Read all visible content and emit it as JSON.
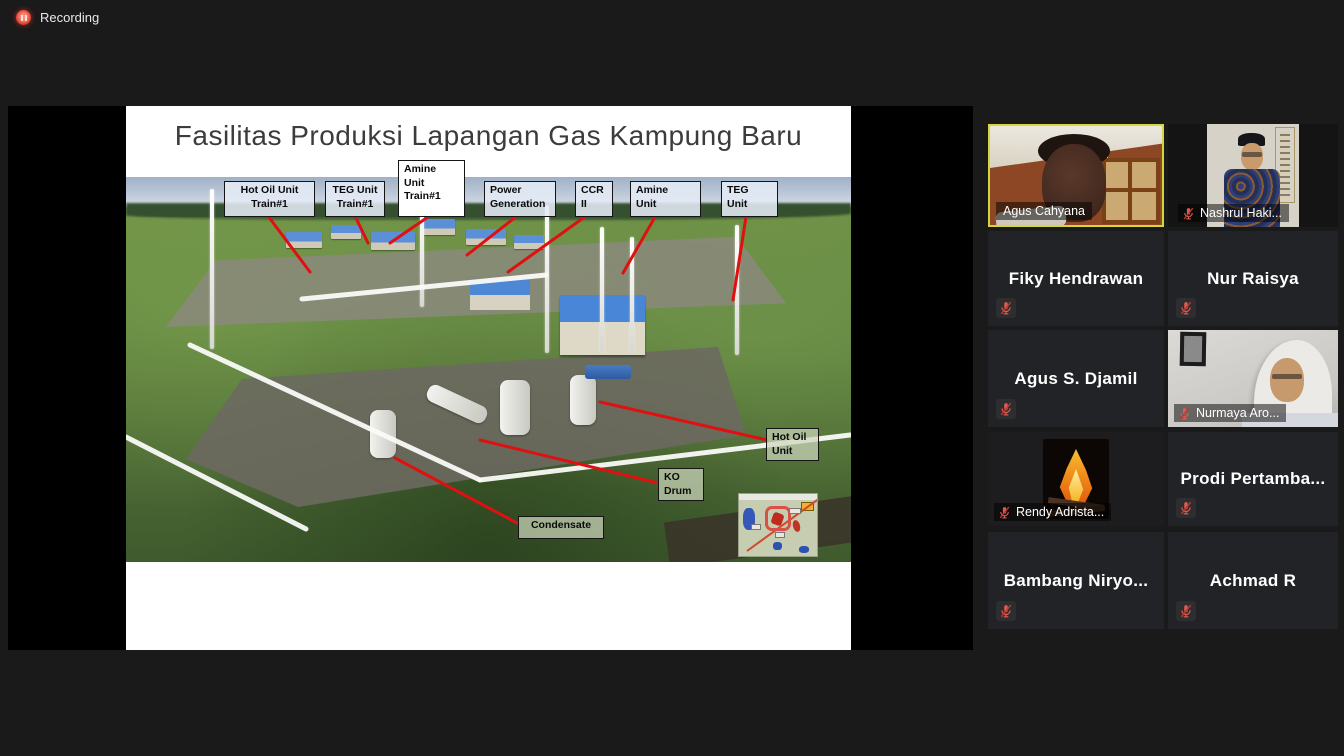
{
  "app": {
    "recording_label": "Recording"
  },
  "slide": {
    "title": "Fasilitas Produksi Lapangan Gas Kampung Baru",
    "unit_labels": [
      {
        "text": "Hot Oil Unit\nTrain#1"
      },
      {
        "text": "TEG Unit\nTrain#1"
      },
      {
        "text": "Amine\nUnit\nTrain#1"
      },
      {
        "text": "Power\nGeneration"
      },
      {
        "text": "CCR\nII"
      },
      {
        "text": "Amine\nUnit"
      },
      {
        "text": "TEG\nUnit"
      },
      {
        "text": "Hot Oil\nUnit"
      },
      {
        "text": "KO\nDrum"
      },
      {
        "text": "Condensate"
      }
    ]
  },
  "participants": [
    {
      "name": "Agus Cahyana",
      "video": true,
      "muted": false,
      "active_speaker": true
    },
    {
      "name": "Nashrul Haki...",
      "video": true,
      "muted": true
    },
    {
      "name": "Fiky Hendrawan",
      "video": false,
      "muted": true
    },
    {
      "name": "Nur Raisya",
      "video": false,
      "muted": true
    },
    {
      "name": "Agus S. Djamil",
      "video": false,
      "muted": true
    },
    {
      "name": "Nurmaya Aro...",
      "video": true,
      "muted": true
    },
    {
      "name": "Rendy Adrista...",
      "video": false,
      "muted": true,
      "avatar": "bonfire-photo"
    },
    {
      "name": "Prodi Pertamba...",
      "video": false,
      "muted": true
    },
    {
      "name": "Bambang Niryo...",
      "video": false,
      "muted": true
    },
    {
      "name": "Achmad R",
      "video": false,
      "muted": true
    }
  ],
  "colors": {
    "stage_background": "#000000",
    "app_background": "#1a1a1a",
    "annotation_red": "#e01010",
    "active_speaker_border": "#d3d83e",
    "muted_mic_red": "#e05a52"
  }
}
